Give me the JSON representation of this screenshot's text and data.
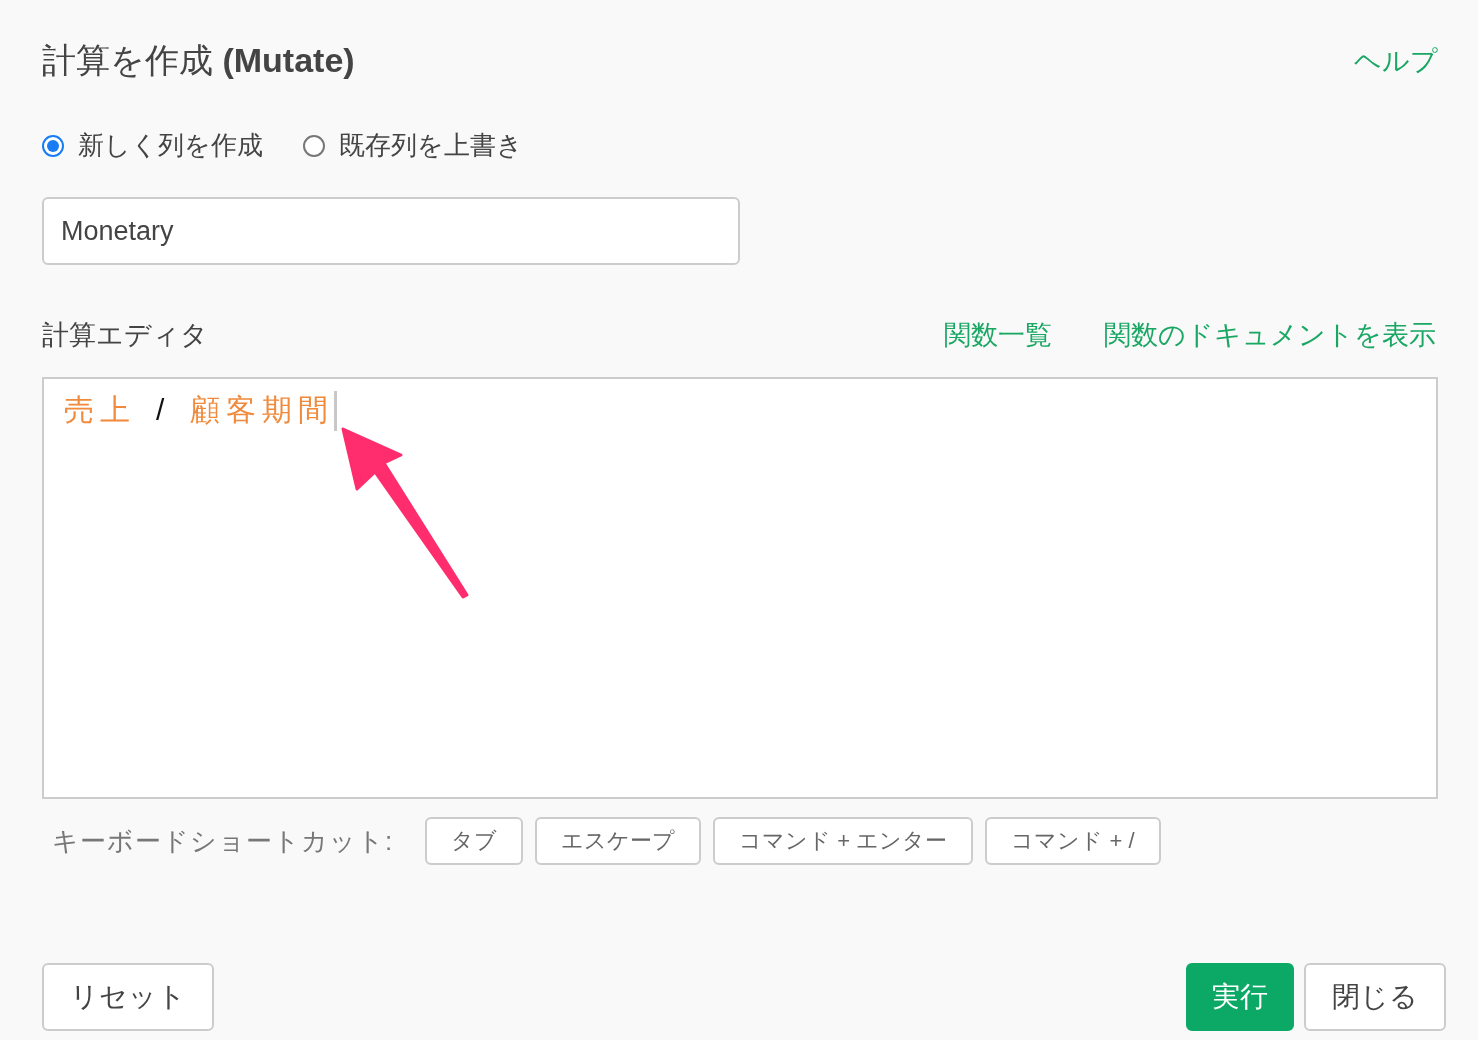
{
  "dialog": {
    "title": "計算を作成 **(Mutate)**",
    "help_link": "ヘルプ"
  },
  "mode_options": [
    {
      "label": "新しく列を作成",
      "selected": true
    },
    {
      "label": "既存列を上書き",
      "selected": false
    }
  ],
  "column_name": {
    "value": "Monetary"
  },
  "editor": {
    "label": "計算エディタ",
    "links": [
      "関数一覧",
      "関数のドキュメントを表示"
    ],
    "tokens": [
      {
        "kind": "column",
        "text": "売上"
      },
      {
        "kind": "operator",
        "text": "/"
      },
      {
        "kind": "column",
        "text": "顧客期間"
      }
    ]
  },
  "shortcuts": {
    "label": "キーボードショートカット:",
    "keys": [
      "タブ",
      "エスケープ",
      "コマンド + エンター",
      "コマンド + /"
    ]
  },
  "buttons": [
    {
      "kind": "secondary",
      "label": "リセット"
    },
    {
      "kind": "primary",
      "label": "実行"
    },
    {
      "kind": "secondary",
      "label": "閉じる"
    }
  ]
}
